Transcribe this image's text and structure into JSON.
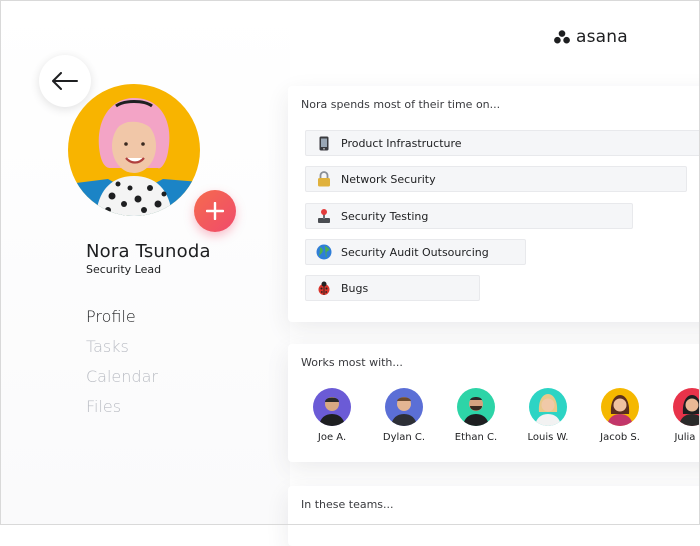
{
  "brand": {
    "logo_text": "asana"
  },
  "profile": {
    "name": "Nora Tsunoda",
    "role": "Security Lead"
  },
  "nav": [
    {
      "label": "Profile",
      "active": true
    },
    {
      "label": "Tasks",
      "active": false
    },
    {
      "label": "Calendar",
      "active": false
    },
    {
      "label": "Files",
      "active": false
    }
  ],
  "time_card": {
    "title": "Nora spends most of their time on...",
    "items": [
      {
        "label": "Product Infrastructure",
        "icon": "phone-icon"
      },
      {
        "label": "Network Security",
        "icon": "padlock-icon"
      },
      {
        "label": "Security Testing",
        "icon": "joystick-icon"
      },
      {
        "label": "Security Audit Outsourcing",
        "icon": "globe-icon"
      },
      {
        "label": "Bugs",
        "icon": "ladybug-icon"
      }
    ]
  },
  "works_card": {
    "title": "Works most with...",
    "people": [
      {
        "name": "Joe A.",
        "color": "#6b5bd6"
      },
      {
        "name": "Dylan C.",
        "color": "#5b6fd6"
      },
      {
        "name": "Ethan C.",
        "color": "#2dd4a7"
      },
      {
        "name": "Louis W.",
        "color": "#2dd4c4"
      },
      {
        "name": "Jacob S.",
        "color": "#f5b800"
      },
      {
        "name": "Julia G.",
        "color": "#e8334a"
      }
    ]
  },
  "teams_card": {
    "title": "In these teams..."
  },
  "colors": {
    "accent": "#f04a6b",
    "avatar_bg": "#f8b400"
  }
}
